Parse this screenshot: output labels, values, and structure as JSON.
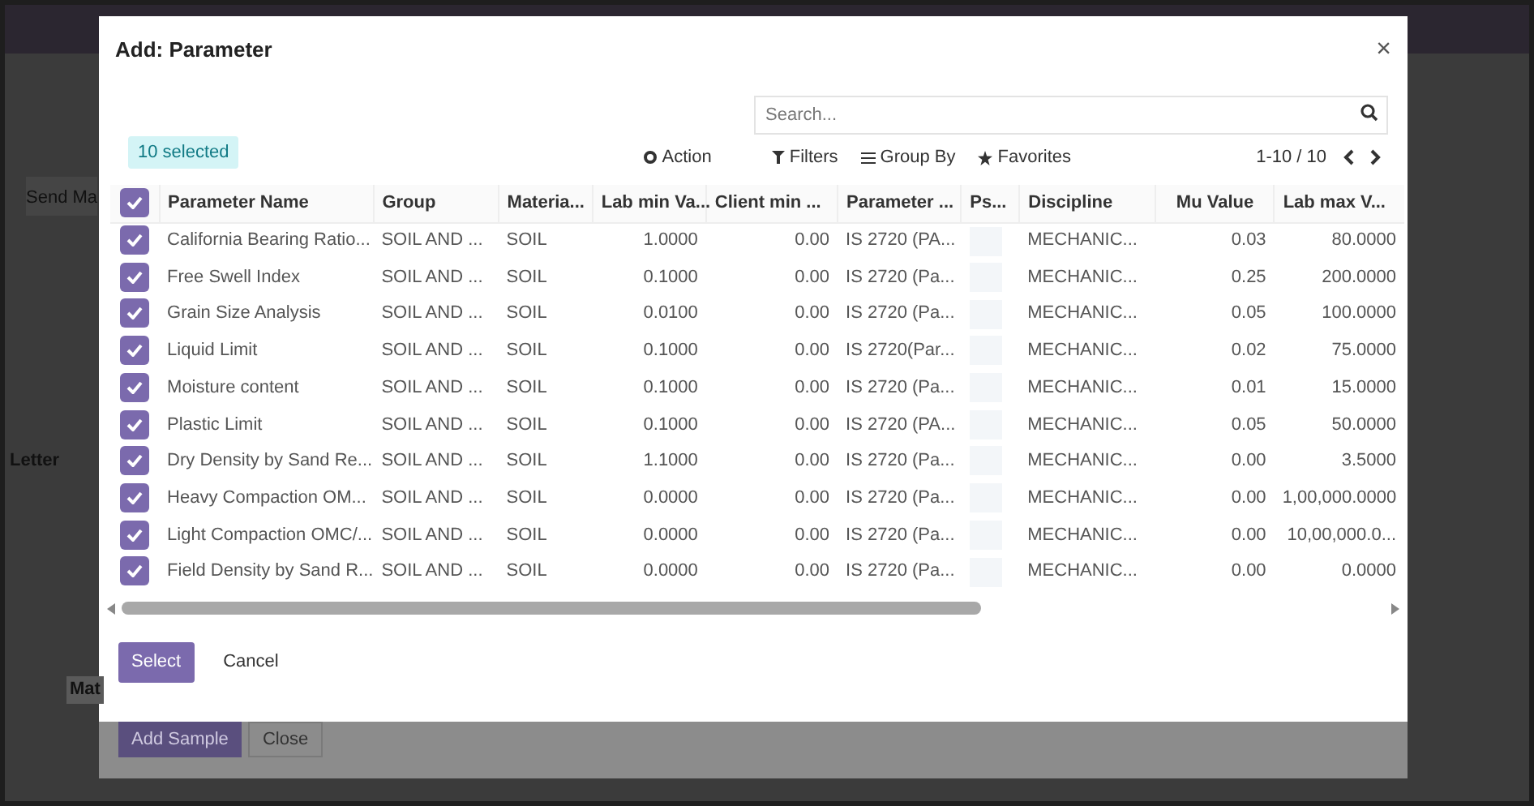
{
  "background": {
    "side_labels": [
      "Send Ma",
      "Letter",
      "Mat"
    ],
    "buttons": [
      {
        "label": "Add Sample",
        "kind": "primary"
      },
      {
        "label": "Close",
        "kind": "secondary"
      }
    ]
  },
  "dialog": {
    "title": "Add: Parameter",
    "close": "×",
    "search": {
      "placeholder": "Search..."
    },
    "selection_badge": "10 selected",
    "toolbar": [
      {
        "label": "Action",
        "kind": "action"
      },
      {
        "label": "Filters",
        "kind": "filter"
      },
      {
        "label": "Group By",
        "kind": "group"
      },
      {
        "label": "Favorites",
        "kind": "favorite"
      }
    ],
    "pager": "1-10 / 10",
    "table": {
      "all_checked": true,
      "columns": [
        "Parameter Name",
        "Group",
        "Materia...",
        "Lab min Va...",
        "Client min ...",
        "Parameter ...",
        "Ps...",
        "Discipline",
        "Mu Value",
        "Lab max V..."
      ],
      "rows": [
        {
          "checked": true,
          "cells": [
            "California Bearing Ratio...",
            "SOIL AND ...",
            "SOIL",
            "1.0000",
            "0.00",
            "IS 2720 (PA...",
            "",
            "MECHANIC...",
            "0.03",
            "80.0000"
          ]
        },
        {
          "checked": true,
          "cells": [
            "Free Swell Index",
            "SOIL AND ...",
            "SOIL",
            "0.1000",
            "0.00",
            "IS 2720 (Pa...",
            "",
            "MECHANIC...",
            "0.25",
            "200.0000"
          ]
        },
        {
          "checked": true,
          "cells": [
            "Grain Size Analysis",
            "SOIL AND ...",
            "SOIL",
            "0.0100",
            "0.00",
            "IS 2720 (Pa...",
            "",
            "MECHANIC...",
            "0.05",
            "100.0000"
          ]
        },
        {
          "checked": true,
          "cells": [
            "Liquid Limit",
            "SOIL AND ...",
            "SOIL",
            "0.1000",
            "0.00",
            "IS 2720(Par...",
            "",
            "MECHANIC...",
            "0.02",
            "75.0000"
          ]
        },
        {
          "checked": true,
          "cells": [
            "Moisture content",
            "SOIL AND ...",
            "SOIL",
            "0.1000",
            "0.00",
            "IS 2720 (Pa...",
            "",
            "MECHANIC...",
            "0.01",
            "15.0000"
          ]
        },
        {
          "checked": true,
          "cells": [
            "Plastic Limit",
            "SOIL AND ...",
            "SOIL",
            "0.1000",
            "0.00",
            "IS 2720 (PA...",
            "",
            "MECHANIC...",
            "0.05",
            "50.0000"
          ]
        },
        {
          "checked": true,
          "cells": [
            "Dry Density by Sand Re...",
            "SOIL AND ...",
            "SOIL",
            "1.1000",
            "0.00",
            "IS 2720 (Pa...",
            "",
            "MECHANIC...",
            "0.00",
            "3.5000"
          ]
        },
        {
          "checked": true,
          "cells": [
            "Heavy Compaction OM...",
            "SOIL AND ...",
            "SOIL",
            "0.0000",
            "0.00",
            "IS 2720 (Pa...",
            "",
            "MECHANIC...",
            "0.00",
            "1,00,000.0000"
          ]
        },
        {
          "checked": true,
          "cells": [
            "Light Compaction OMC/...",
            "SOIL AND ...",
            "SOIL",
            "0.0000",
            "0.00",
            "IS 2720 (Pa...",
            "",
            "MECHANIC...",
            "0.00",
            "10,00,000.0..."
          ]
        },
        {
          "checked": true,
          "cells": [
            "Field Density by Sand R...",
            "SOIL AND ...",
            "SOIL",
            "0.0000",
            "0.00",
            "IS 2720 (Pa...",
            "",
            "MECHANIC...",
            "0.00",
            "0.0000"
          ]
        }
      ]
    },
    "footer": [
      {
        "label": "Select",
        "kind": "primary"
      },
      {
        "label": "Cancel",
        "kind": "secondary"
      }
    ]
  }
}
